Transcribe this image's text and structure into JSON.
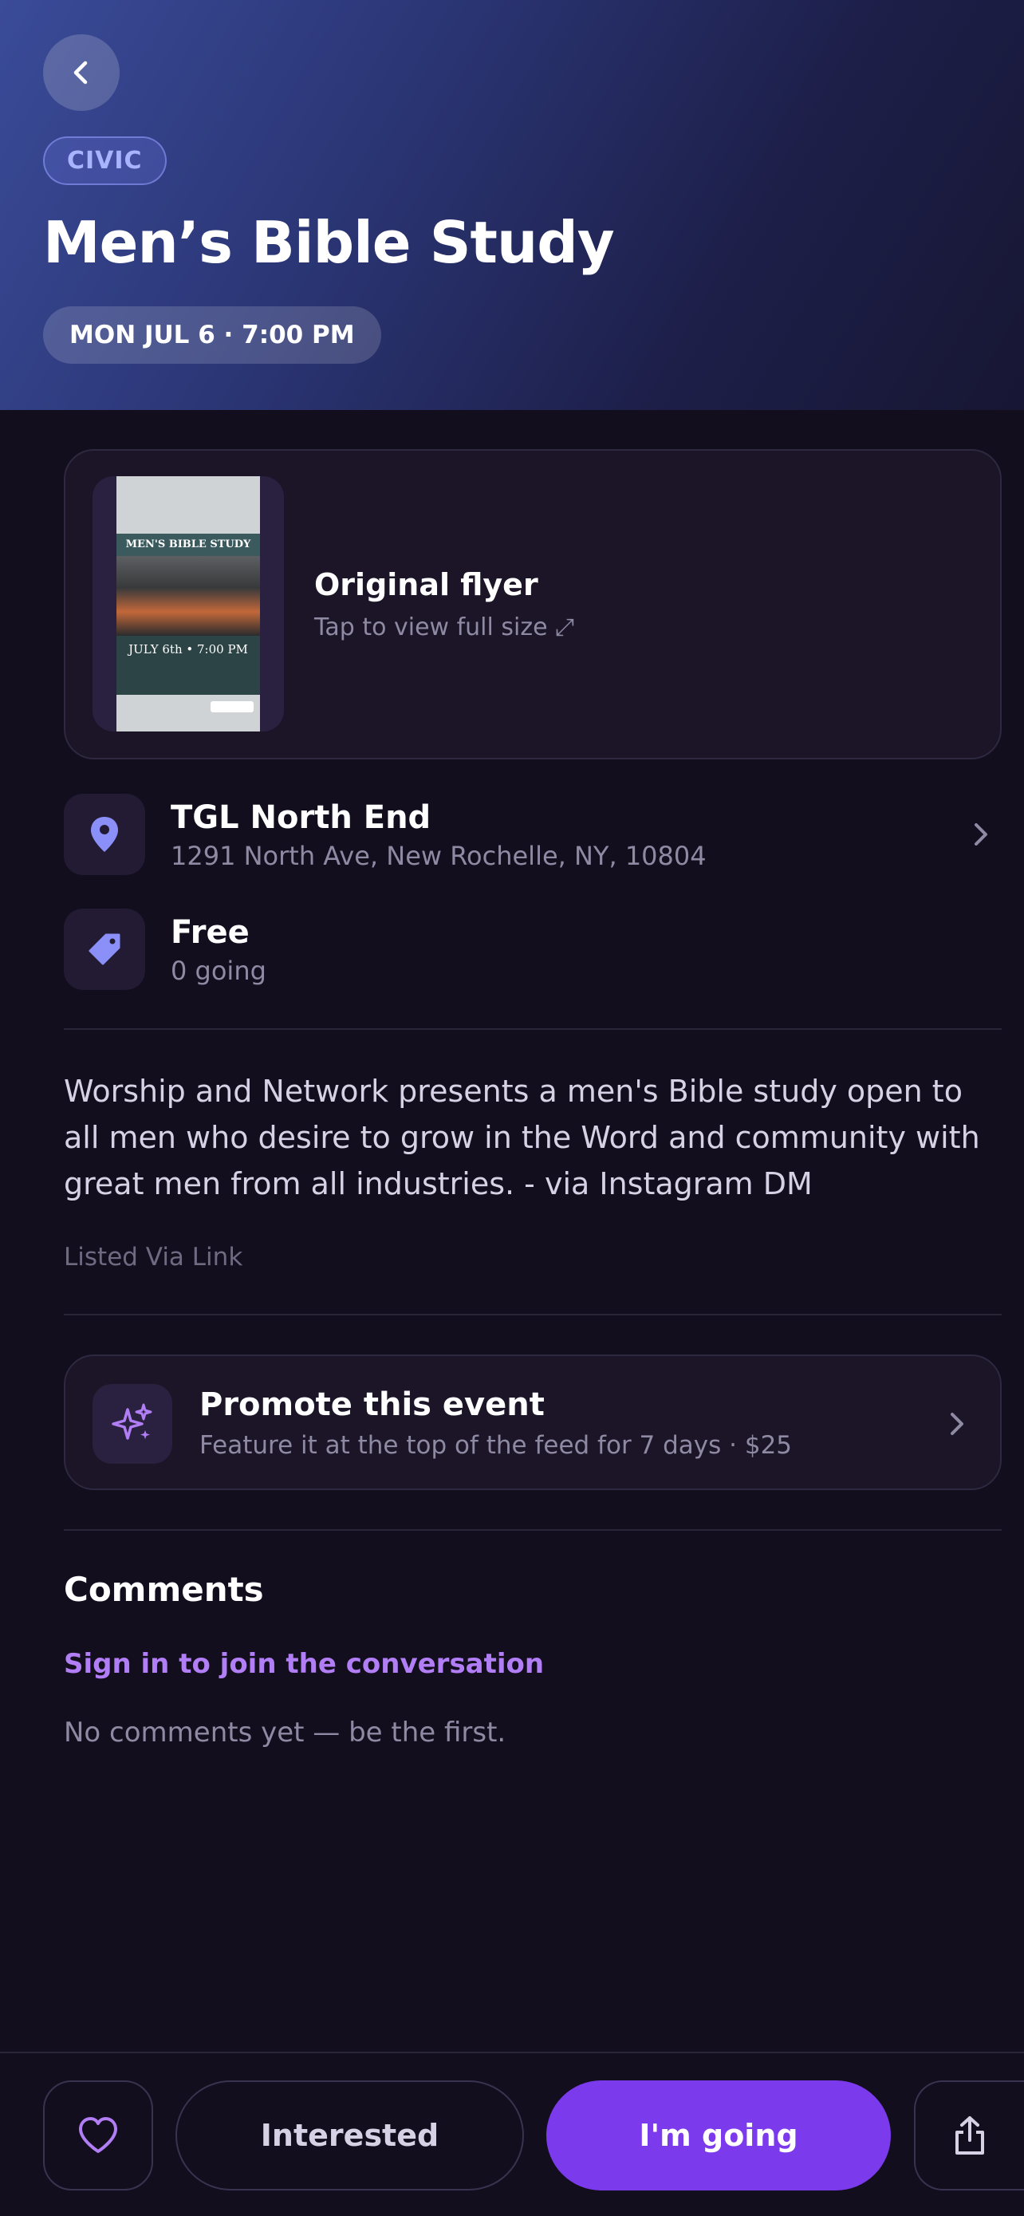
{
  "header": {
    "back_icon": "chevron-left-icon",
    "category": "CIVIC",
    "title": "Men’s Bible Study",
    "datetime": "MON JUL 6 · 7:00 PM",
    "gradient_colors": [
      "#3a4b98",
      "#171633"
    ]
  },
  "flyer": {
    "title": "Original flyer",
    "subtitle": "Tap to view full size ⤢"
  },
  "venue": {
    "icon": "map-pin-icon",
    "name": "TGL North End",
    "address": "1291 North Ave, New Rochelle, NY, 10804"
  },
  "ticket": {
    "icon": "tag-icon",
    "price": "Free",
    "going": "0 going"
  },
  "description": "Worship and Network presents a men's Bible study open to all men who desire to grow in the Word and community with great men from all industries. - via Instagram DM",
  "source_note": "Listed Via Link",
  "promote": {
    "icon": "sparkles-icon",
    "title": "Promote this event",
    "subtitle": "Feature it at the top of the feed for 7 days · $25"
  },
  "comments": {
    "heading": "Comments",
    "signin_link": "Sign in to join the conversation",
    "empty_text": "No comments yet — be the first."
  },
  "actions": {
    "heart_icon": "heart-icon",
    "interested_label": "Interested",
    "going_label": "I'm going",
    "share_icon": "share-icon"
  },
  "colors": {
    "background": "#120e1e",
    "accent": "#7c3aed",
    "link": "#b17ef5",
    "icon_accent": "#8b8ff8"
  }
}
